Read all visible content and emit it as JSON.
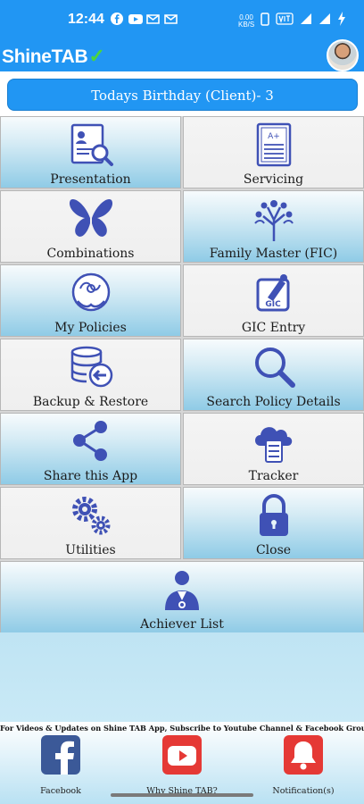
{
  "status_bar": {
    "time": "12:44",
    "net_speed_top": "0.00",
    "net_speed_bottom": "KB/S"
  },
  "app": {
    "brand_name": "ShineTAB",
    "brand_check": "✓"
  },
  "banner": {
    "text": "Todays Birthday (Client)- 3"
  },
  "menu": [
    {
      "label": "Presentation",
      "icon": "presentation-icon"
    },
    {
      "label": "Servicing",
      "icon": "servicing-icon"
    },
    {
      "label": "Combinations",
      "icon": "butterfly-icon"
    },
    {
      "label": "Family Master (FIC)",
      "icon": "family-tree-icon"
    },
    {
      "label": "My Policies",
      "icon": "globe-hands-icon"
    },
    {
      "label": "GIC Entry",
      "icon": "gic-icon"
    },
    {
      "label": "Backup & Restore",
      "icon": "database-restore-icon"
    },
    {
      "label": "Search Policy Details",
      "icon": "search-icon"
    },
    {
      "label": "Share this App",
      "icon": "share-icon"
    },
    {
      "label": "Tracker",
      "icon": "cloud-server-icon"
    },
    {
      "label": "Utilities",
      "icon": "gears-icon"
    },
    {
      "label": "Close",
      "icon": "lock-icon"
    },
    {
      "label": "Achiever List",
      "icon": "achiever-icon"
    }
  ],
  "footer": {
    "note": "For Videos & Updates on Shine TAB App, Subscribe to Youtube Channel & Facebook Group.",
    "buttons": [
      {
        "label": "Facebook",
        "icon": "facebook-icon"
      },
      {
        "label": "Why Shine TAB?",
        "icon": "youtube-icon"
      },
      {
        "label": "Notification(s)",
        "icon": "bell-icon"
      }
    ]
  },
  "colors": {
    "primary": "#2196f3",
    "icon_blue": "#3f51b5",
    "facebook": "#3b5998",
    "youtube": "#e53935",
    "bell_bg": "#e53935"
  }
}
